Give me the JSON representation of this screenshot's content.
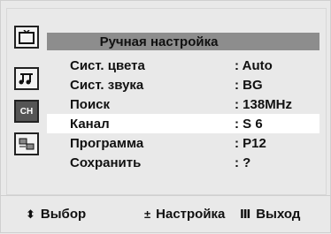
{
  "menu": {
    "title": "Ручная настройка",
    "items": [
      {
        "label": "Сист. цвета",
        "value": ": Auto"
      },
      {
        "label": "Сист. звука",
        "value": ": BG"
      },
      {
        "label": "Поиск",
        "value": ": 138MHz"
      },
      {
        "label": "Канал",
        "value": ": S 6"
      },
      {
        "label": "Программа",
        "value": ": P12"
      },
      {
        "label": "Сохранить",
        "value": ": ?"
      }
    ],
    "selected_index": 3
  },
  "sidebar": {
    "icons": [
      {
        "name": "picture-icon"
      },
      {
        "name": "sound-icon"
      },
      {
        "name": "channel-icon",
        "label": "CH"
      },
      {
        "name": "setup-icon"
      }
    ],
    "selected": "channel-icon"
  },
  "footer": {
    "select_symbol": "⬍",
    "select_label": "Выбор",
    "adjust_symbol": "±",
    "adjust_label": "Настройка",
    "exit_symbol": "Ⅲ",
    "exit_label": "Выход"
  },
  "colors": {
    "background": "#e9e9e9",
    "title_bar": "#8d8d8d",
    "selected_row": "#ffffff",
    "selected_icon": "#555555"
  }
}
